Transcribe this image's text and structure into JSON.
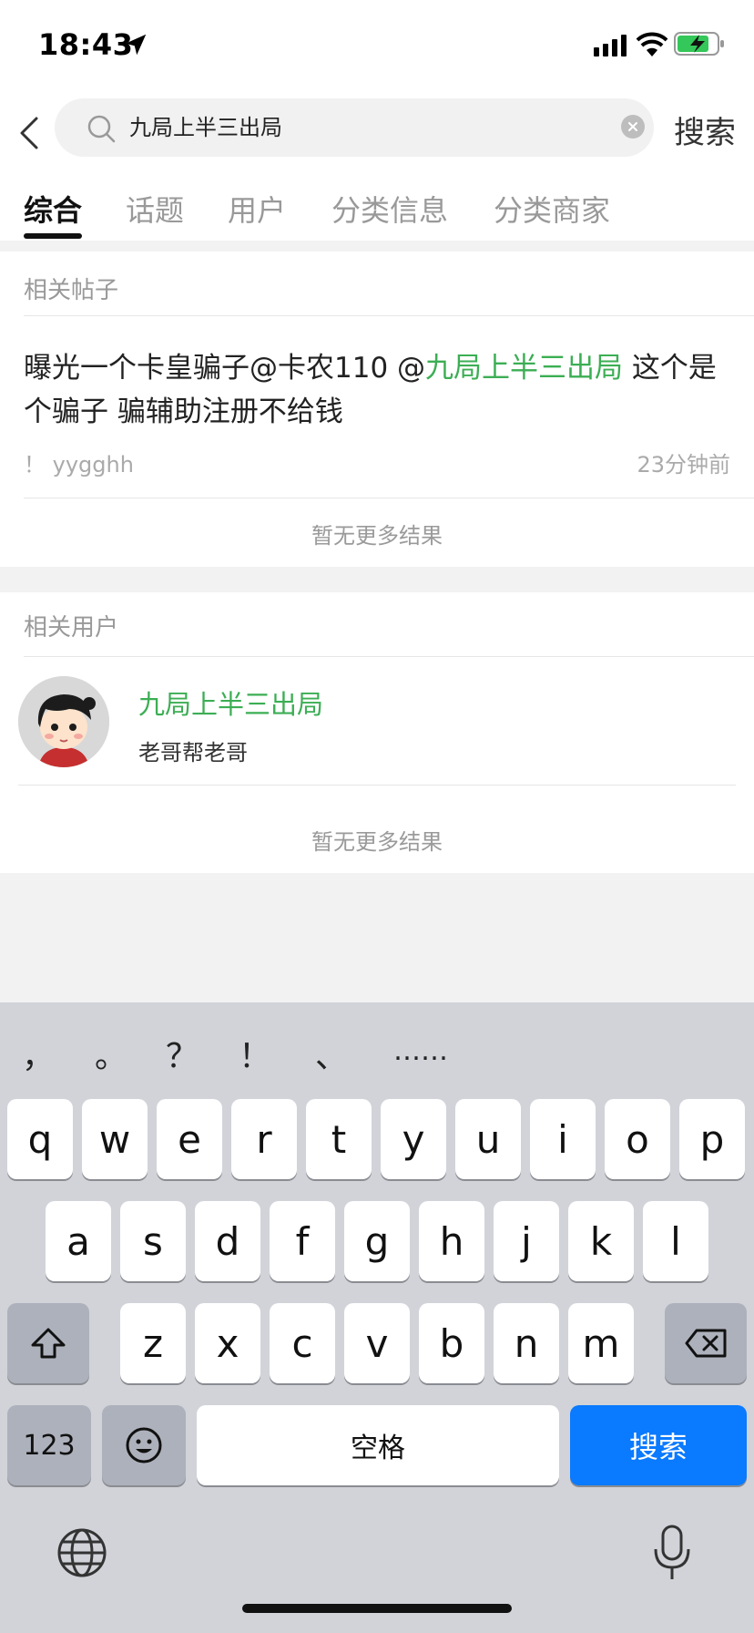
{
  "status_bar": {
    "time": "18:43"
  },
  "search": {
    "query": "九局上半三出局",
    "action_label": "搜索"
  },
  "tabs": [
    {
      "label": "综合",
      "active": true
    },
    {
      "label": "话题",
      "active": false
    },
    {
      "label": "用户",
      "active": false
    },
    {
      "label": "分类信息",
      "active": false
    },
    {
      "label": "分类商家",
      "active": false
    }
  ],
  "posts_section": {
    "title": "相关帖子",
    "post": {
      "text_before": "曝光一个卡皇骗子@卡农110 @",
      "highlight": "九局上半三出局",
      "text_after": " 这个是个骗子 骗辅助注册不给钱",
      "author": "！ yygghh",
      "time": "23分钟前"
    },
    "no_more": "暂无更多结果"
  },
  "users_section": {
    "title": "相关用户",
    "user": {
      "name": "九局上半三出局",
      "signature": "老哥帮老哥"
    },
    "no_more": "暂无更多结果"
  },
  "keyboard": {
    "punctuation": [
      "，",
      "。",
      "？",
      "！",
      "、",
      "……"
    ],
    "row1": [
      "q",
      "w",
      "e",
      "r",
      "t",
      "y",
      "u",
      "i",
      "o",
      "p"
    ],
    "row2": [
      "a",
      "s",
      "d",
      "f",
      "g",
      "h",
      "j",
      "k",
      "l"
    ],
    "row3": [
      "z",
      "x",
      "c",
      "v",
      "b",
      "n",
      "m"
    ],
    "num_label": "123",
    "space_label": "空格",
    "search_label": "搜索"
  },
  "colors": {
    "accent_green": "#3cae54",
    "keyboard_blue": "#0a7aff"
  }
}
